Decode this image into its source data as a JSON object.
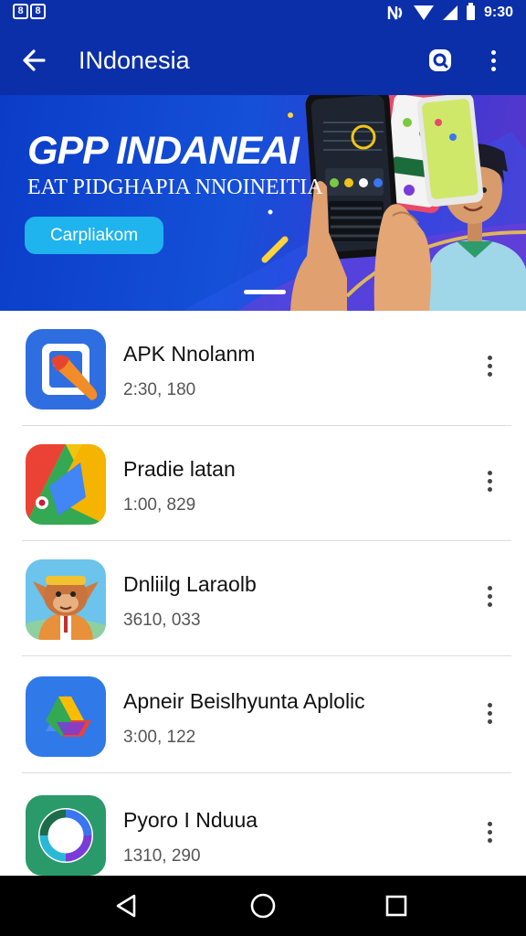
{
  "status_bar": {
    "left_icons": [
      "8",
      "8"
    ],
    "time": "9:30",
    "indicators": [
      "nfc-icon",
      "wifi-icon",
      "signal-icon",
      "battery-icon"
    ]
  },
  "app_bar": {
    "title": "INdonesia",
    "icons": [
      "back-arrow-icon",
      "search-icon",
      "more-vert-icon"
    ],
    "color": "#0b2fa8"
  },
  "banner": {
    "headline": "GPP INDANEAI",
    "subtitle": "EAT PIDGHAPIA NNOINEITIA",
    "cta_label": "Carpliakom",
    "cta_color": "#1fb4ee"
  },
  "apps": [
    {
      "name": "APK Nnolanm",
      "count": "2:30, 180",
      "icon": "brush-icon"
    },
    {
      "name": "Pradie latan",
      "count": "1:00, 829",
      "icon": "play-store-icon"
    },
    {
      "name": "Dnliilg Laraolb",
      "count": "3610, 033",
      "icon": "monkey-mascot-icon"
    },
    {
      "name": "Apneir Beislhyunta Aplolic",
      "count": "3:00, 122",
      "icon": "drive-icon"
    },
    {
      "name": "Pyoro I Nduua",
      "count": "1310, 290",
      "icon": "ring-logo-icon"
    }
  ],
  "nav_bar": {
    "icons": [
      "back-triangle-icon",
      "home-circle-icon",
      "recents-square-icon"
    ]
  }
}
